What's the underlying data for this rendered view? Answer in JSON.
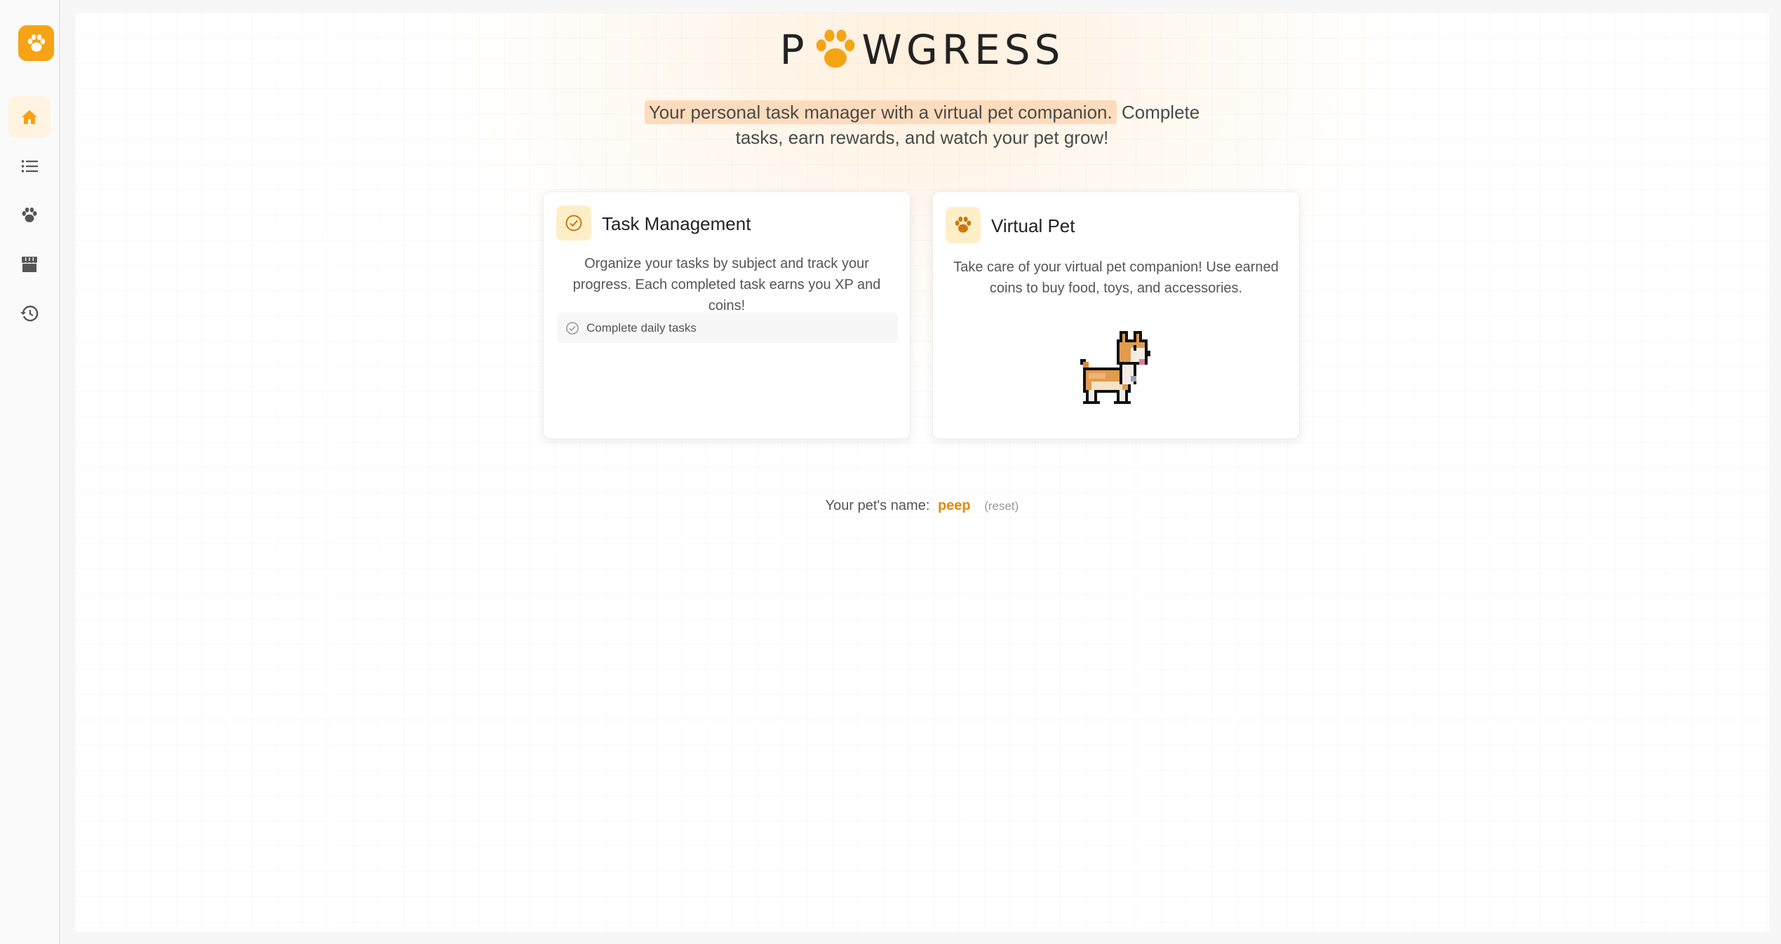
{
  "sidebar": {
    "logo_icon": "paw-icon",
    "items": [
      {
        "icon": "home-icon",
        "active": true
      },
      {
        "icon": "list-icon",
        "active": false
      },
      {
        "icon": "paw-icon",
        "active": false
      },
      {
        "icon": "store-icon",
        "active": false
      },
      {
        "icon": "history-icon",
        "active": false
      }
    ]
  },
  "header": {
    "brand_left": "P",
    "brand_right": "WGRESS",
    "tagline_highlight": "Your personal task manager with a virtual pet companion.",
    "tagline_rest_1": "Complete",
    "tagline_rest_2": "tasks, earn rewards, and watch your pet grow!"
  },
  "cards": {
    "tasks": {
      "icon": "check-circle-icon",
      "title": "Task Management",
      "desc_1": "Organize your tasks by subject and track your",
      "desc_2": "progress. Each completed task earns you XP and coins!",
      "task_item": "Complete daily tasks"
    },
    "pet": {
      "icon": "paw-icon",
      "title": "Virtual Pet",
      "desc_1": "Take care of your virtual pet companion! Use earned",
      "desc_2": "coins to buy food, toys, and accessories.",
      "sprite": "corgi-sprite"
    }
  },
  "pet_name": {
    "label": "Your pet's name:",
    "value": "peep",
    "reset": "(reset)"
  },
  "colors": {
    "accent": "#f6a316",
    "highlight": "#fddcbd",
    "name": "#e58a0f"
  }
}
